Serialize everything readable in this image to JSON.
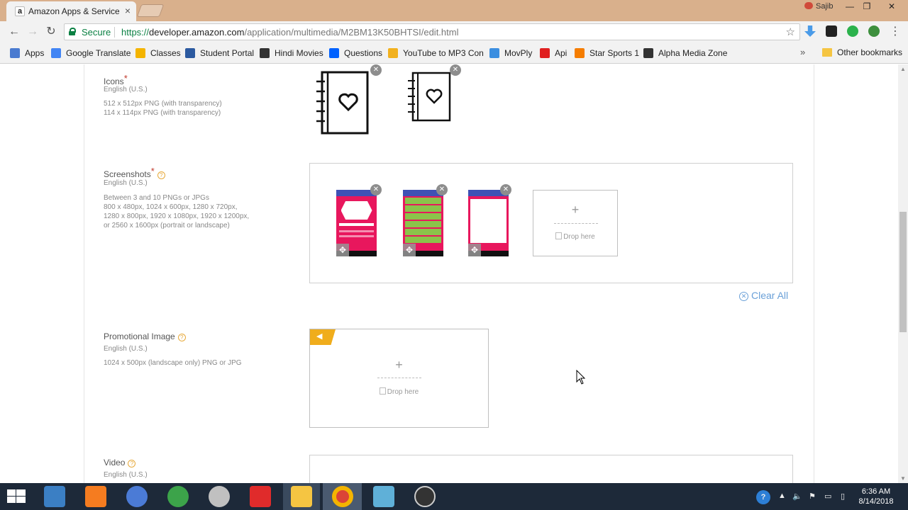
{
  "browser": {
    "tab_title": "Amazon Apps & Services",
    "tab_favicon": "a",
    "user_name": "Sajib",
    "secure_label": "Secure",
    "url_scheme": "https://",
    "url_host": "developer.amazon.com",
    "url_path": "/application/multimedia/M2BM13K50BHTSI/edit.html"
  },
  "bookmarks": [
    {
      "label": "Apps",
      "icon": "apps-grid-icon",
      "color": "#4a7bd0"
    },
    {
      "label": "Google Translate",
      "icon": "google-translate-icon",
      "color": "#4285f4"
    },
    {
      "label": "Classes",
      "icon": "classroom-icon",
      "color": "#f4b400"
    },
    {
      "label": "Student Portal",
      "icon": "student-portal-icon",
      "color": "#2c5aa0"
    },
    {
      "label": "Hindi Movies",
      "icon": "globe-icon",
      "color": "#333333"
    },
    {
      "label": "Questions",
      "icon": "dropbox-icon",
      "color": "#0061fe"
    },
    {
      "label": "YouTube to MP3 Con",
      "icon": "converter-icon",
      "color": "#f2b11e"
    },
    {
      "label": "MovPly",
      "icon": "movply-icon",
      "color": "#3b8ee0"
    },
    {
      "label": "Api",
      "icon": "youtube-icon",
      "color": "#e02020"
    },
    {
      "label": "Star Sports 1",
      "icon": "blogger-icon",
      "color": "#f57d00"
    },
    {
      "label": "Alpha Media Zone",
      "icon": "globe-icon",
      "color": "#333333"
    }
  ],
  "other_bookmarks": "Other bookmarks",
  "sections": {
    "icons": {
      "label": "Icons",
      "required": "*",
      "locale": "English (U.S.)",
      "spec_1": "512 x 512px PNG (with transparency)",
      "spec_2": "114 x 114px PNG (with transparency)"
    },
    "screenshots": {
      "label": "Screenshots",
      "required": "*",
      "locale": "English (U.S.)",
      "spec_1": "Between 3 and 10 PNGs or JPGs",
      "spec_2": "800 x 480px, 1024 x 600px, 1280 x 720px,",
      "spec_3": "1280 x 800px, 1920 x 1080px, 1920 x 1200px,",
      "spec_4": "or 2560 x 1600px (portrait or landscape)",
      "drop_text": "Drop here",
      "clear_all": "Clear All"
    },
    "promotional": {
      "label": "Promotional Image",
      "locale": "English (U.S.)",
      "spec_1": "1024 x 500px (landscape only) PNG or JPG",
      "drop_text": "Drop here"
    },
    "video": {
      "label": "Video",
      "locale": "English (U.S.)"
    }
  },
  "taskbar": {
    "time": "6:36 AM",
    "date": "8/14/2018"
  },
  "colors": {
    "accent_pink": "#e8175d",
    "accent_green": "#8bc34a",
    "promo_tag": "#f0ad1c",
    "link_blue": "#6aa0d8"
  }
}
